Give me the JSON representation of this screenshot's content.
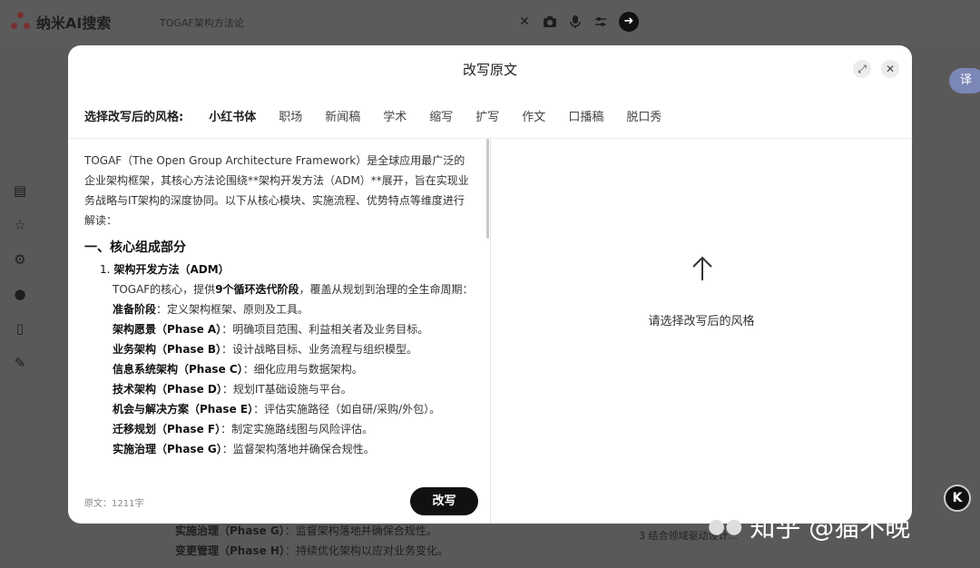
{
  "app": {
    "logo_text": "纳米AI搜索",
    "search_query": "TOGAF架构方法论",
    "translate_label": "译"
  },
  "modal": {
    "title": "改写原文",
    "styles_label": "选择改写后的风格:",
    "styles": [
      "小红书体",
      "职场",
      "新闻稿",
      "学术",
      "缩写",
      "扩写",
      "作文",
      "口播稿",
      "脱口秀"
    ],
    "active_style": "小红书体",
    "intro": "TOGAF（The Open Group Architecture Framework）是全球应用最广泛的企业架构框架，其核心方法论围绕**架构开发方法（ADM）**展开，旨在实现业务战略与IT架构的深度协同。以下从核心模块、实施流程、优势特点等维度进行解读：",
    "section_title": "一、核心组成部分",
    "item_num": "1.",
    "item_title": "架构开发方法（ADM）",
    "item_desc_pre": "TOGAF的核心，提供",
    "item_desc_bold": "9个循环迭代阶段",
    "item_desc_post": "，覆盖从规划到治理的全生命周期：",
    "phases": [
      {
        "name": "准备阶段",
        "desc": "：定义架构框架、原则及工具。"
      },
      {
        "name": "架构愿景（Phase A）",
        "desc": "：明确项目范围、利益相关者及业务目标。"
      },
      {
        "name": "业务架构（Phase B）",
        "desc": "：设计战略目标、业务流程与组织模型。"
      },
      {
        "name": "信息系统架构（Phase C）",
        "desc": "：细化应用与数据架构。"
      },
      {
        "name": "技术架构（Phase D）",
        "desc": "：规划IT基础设施与平台。"
      },
      {
        "name": "机会与解决方案（Phase E）",
        "desc": "：评估实施路径（如自研/采购/外包）。"
      },
      {
        "name": "迁移规划（Phase F）",
        "desc": "：制定实施路线图与风险评估。"
      },
      {
        "name": "实施治理（Phase G）",
        "desc": "：监督架构落地并确保合规性。"
      }
    ],
    "char_count": "原文：1211字",
    "rewrite_button": "改写",
    "right_hint": "请选择改写后的风格"
  },
  "background": {
    "bottom_lines": [
      {
        "name": "实施治理（Phase G）",
        "desc": "：监督架构落地并确保合规性。"
      },
      {
        "name": "变更管理（Phase H）",
        "desc": "：持续优化架构以应对业务变化。"
      }
    ],
    "right_text": "3  结合领域驱动设计..."
  },
  "watermark": {
    "text": "知乎 @猫不晚",
    "badge": "K"
  }
}
